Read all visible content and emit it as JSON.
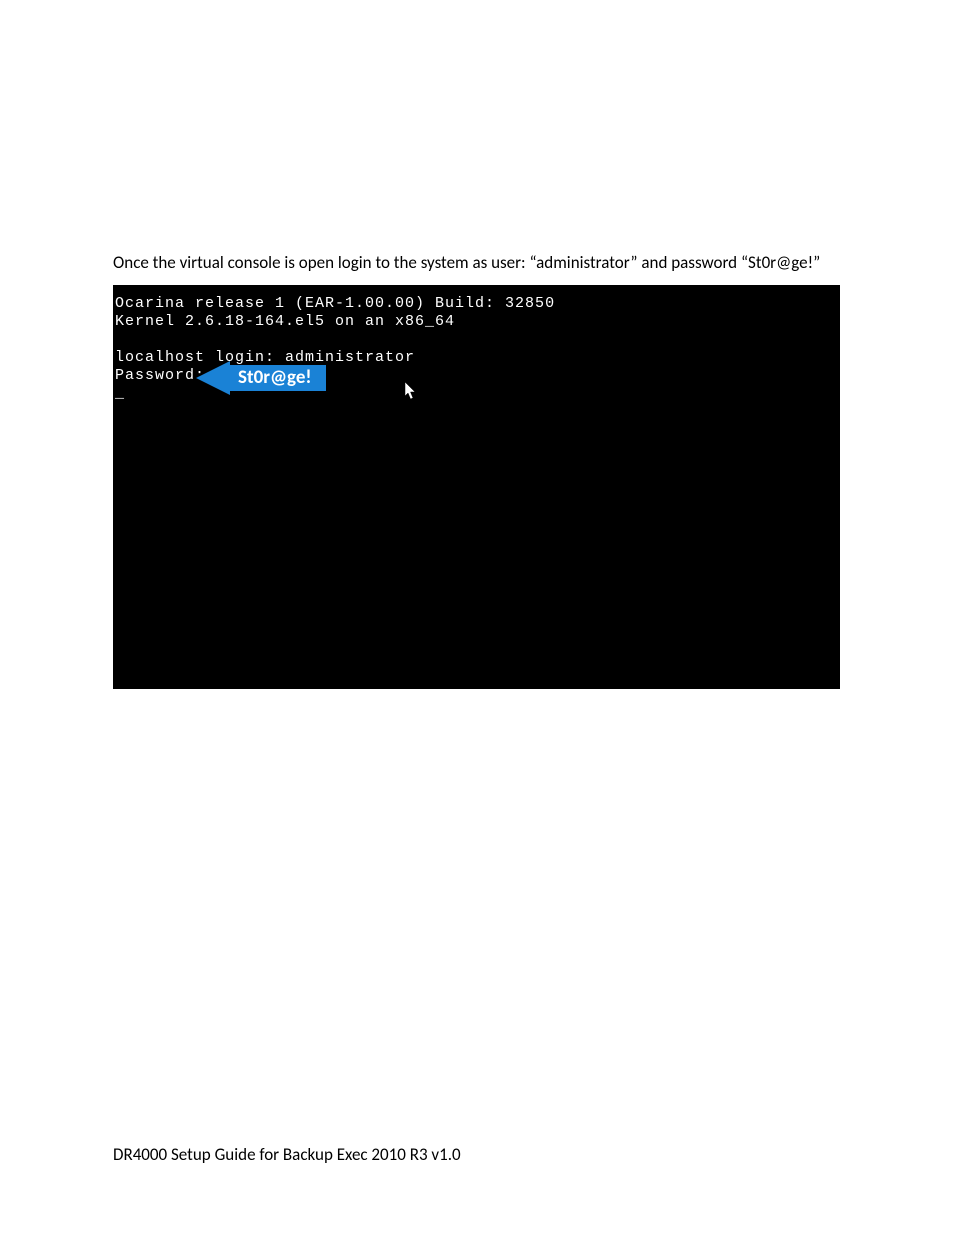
{
  "instruction": "Once the virtual console is open login to the system as user: “administrator” and password “St0r@ge!”",
  "console": {
    "line1": "Ocarina release 1 (EAR-1.00.00) Build: 32850",
    "line2": "Kernel 2.6.18-164.el5 on an x86_64",
    "line3": "localhost login: administrator",
    "line4": "Password:",
    "cursor": "_"
  },
  "callout": {
    "label": "St0r@ge!"
  },
  "footer": "DR4000 Setup Guide for Backup Exec 2010 R3 v1.0"
}
